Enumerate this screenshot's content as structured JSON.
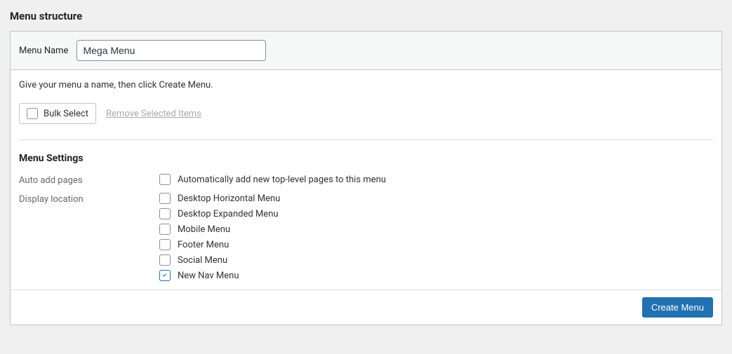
{
  "title": "Menu structure",
  "menu_name": {
    "label": "Menu Name",
    "value": "Mega Menu"
  },
  "intro": "Give your menu a name, then click Create Menu.",
  "bulk": {
    "select_label": "Bulk Select",
    "remove_label": "Remove Selected Items"
  },
  "settings": {
    "title": "Menu Settings",
    "auto_add": {
      "label": "Auto add pages",
      "option": "Automatically add new top-level pages to this menu",
      "checked": false
    },
    "display_location": {
      "label": "Display location",
      "options": [
        {
          "label": "Desktop Horizontal Menu",
          "checked": false
        },
        {
          "label": "Desktop Expanded Menu",
          "checked": false
        },
        {
          "label": "Mobile Menu",
          "checked": false
        },
        {
          "label": "Footer Menu",
          "checked": false
        },
        {
          "label": "Social Menu",
          "checked": false
        },
        {
          "label": "New Nav Menu",
          "checked": true
        }
      ]
    }
  },
  "actions": {
    "create": "Create Menu"
  }
}
